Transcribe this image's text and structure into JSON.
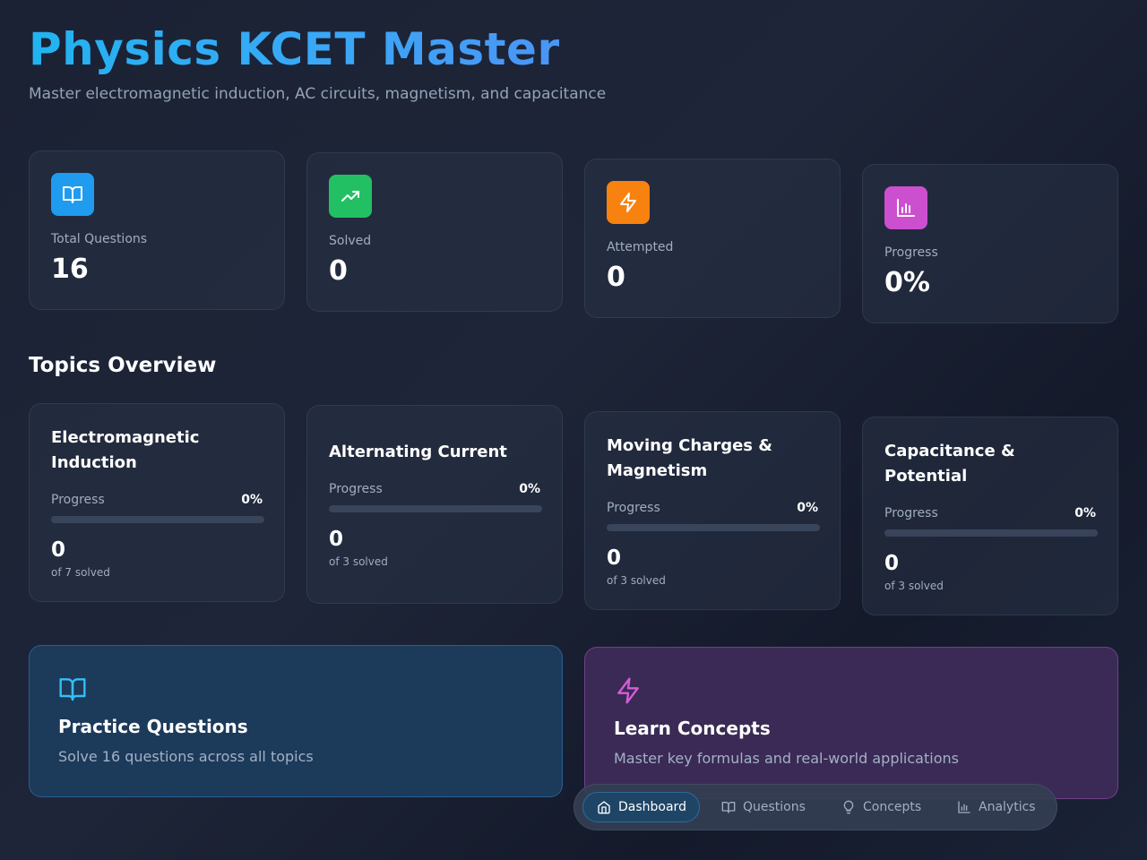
{
  "header": {
    "title": "Physics KCET Master",
    "subtitle": "Master electromagnetic induction, AC circuits, magnetism, and capacitance"
  },
  "stats": [
    {
      "label": "Total Questions",
      "value": "16",
      "icon": "book-open-icon",
      "color": "#1f9bf0"
    },
    {
      "label": "Solved",
      "value": "0",
      "icon": "trending-up-icon",
      "color": "#22c063"
    },
    {
      "label": "Attempted",
      "value": "0",
      "icon": "zap-icon",
      "color": "#f8820f"
    },
    {
      "label": "Progress",
      "value": "0%",
      "icon": "bar-chart-icon",
      "color": "#cc4fd0"
    }
  ],
  "topics_section": {
    "title": "Topics Overview",
    "progress_label": "Progress",
    "items": [
      {
        "name": "Electromagnetic Induction",
        "progress": "0%",
        "progress_fraction": 0,
        "solved": "0",
        "of_text": "of 7 solved"
      },
      {
        "name": "Alternating Current",
        "progress": "0%",
        "progress_fraction": 0,
        "solved": "0",
        "of_text": "of 3 solved"
      },
      {
        "name": "Moving Charges & Magnetism",
        "progress": "0%",
        "progress_fraction": 0,
        "solved": "0",
        "of_text": "of 3 solved"
      },
      {
        "name": "Capacitance & Potential",
        "progress": "0%",
        "progress_fraction": 0,
        "solved": "0",
        "of_text": "of 3 solved"
      }
    ]
  },
  "actions": {
    "practice": {
      "title": "Practice Questions",
      "desc": "Solve 16 questions across all topics",
      "icon": "book-open-icon",
      "accent": "#38bdf8"
    },
    "learn": {
      "title": "Learn Concepts",
      "desc": "Master key formulas and real-world applications",
      "icon": "zap-icon",
      "accent": "#d65cd6"
    }
  },
  "nav": {
    "items": [
      {
        "label": "Dashboard",
        "icon": "home-icon",
        "active": true
      },
      {
        "label": "Questions",
        "icon": "book-open-icon",
        "active": false
      },
      {
        "label": "Concepts",
        "icon": "lightbulb-icon",
        "active": false
      },
      {
        "label": "Analytics",
        "icon": "bar-chart-icon",
        "active": false
      }
    ]
  }
}
